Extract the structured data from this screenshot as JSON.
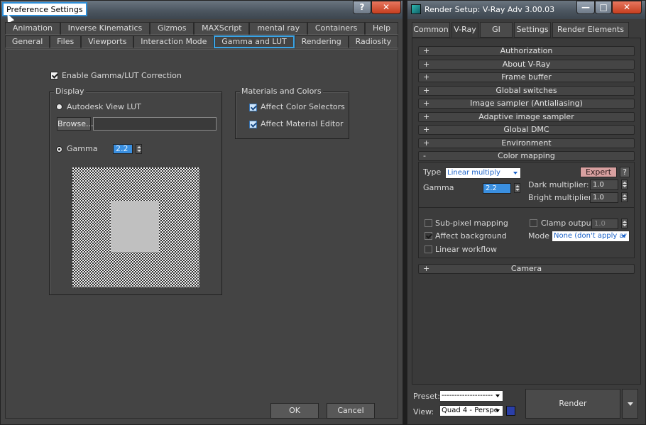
{
  "preferences": {
    "title": "Preference Settings",
    "help_glyph": "?",
    "close_glyph": "✕",
    "tabs_row1": [
      "Animation",
      "Inverse Kinematics",
      "Gizmos",
      "MAXScript",
      "mental ray",
      "Containers",
      "Help"
    ],
    "tabs_row2": [
      "General",
      "Files",
      "Viewports",
      "Interaction Mode",
      "Gamma and LUT",
      "Rendering",
      "Radiosity"
    ],
    "active_tab": "Gamma and LUT",
    "enable_gamma_label": "Enable Gamma/LUT Correction",
    "display_group": "Display",
    "autodesk_lut_label": "Autodesk View LUT",
    "browse_label": "Browse...",
    "lut_path": "",
    "gamma_label": "Gamma",
    "gamma_value": "2.2",
    "materials_group": "Materials and Colors",
    "affect_color_selectors": "Affect Color Selectors",
    "affect_material_editor": "Affect Material Editor",
    "ok_label": "OK",
    "cancel_label": "Cancel"
  },
  "render_setup": {
    "title": "Render Setup: V-Ray Adv 3.00.03",
    "tabs": [
      "Common",
      "V-Ray",
      "GI",
      "Settings",
      "Render Elements"
    ],
    "active_tab": "V-Ray",
    "rollouts_top": [
      {
        "sign": "+",
        "label": "Authorization"
      },
      {
        "sign": "+",
        "label": "About V-Ray"
      },
      {
        "sign": "+",
        "label": "Frame buffer"
      },
      {
        "sign": "+",
        "label": "Global switches"
      },
      {
        "sign": "+",
        "label": "Image sampler (Antialiasing)"
      },
      {
        "sign": "+",
        "label": "Adaptive image sampler"
      },
      {
        "sign": "+",
        "label": "Global DMC"
      },
      {
        "sign": "+",
        "label": "Environment"
      }
    ],
    "color_mapping": {
      "sign": "-",
      "label": "Color mapping",
      "type_label": "Type",
      "type_value": "Linear multiply",
      "expert_label": "Expert",
      "help_label": "?",
      "gamma_label": "Gamma",
      "gamma_value": "2.2",
      "dark_multiplier_label": "Dark multiplier:",
      "dark_multiplier_value": "1.0",
      "bright_multiplier_label": "Bright multiplier:",
      "bright_multiplier_value": "1.0",
      "sub_pixel_label": "Sub-pixel mapping",
      "clamp_output_label": "Clamp output",
      "clamp_value": "1.0",
      "affect_background_label": "Affect background",
      "mode_label": "Mode",
      "mode_value": "None (don't apply ar",
      "linear_workflow_label": "Linear workflow"
    },
    "camera_rollout": {
      "sign": "+",
      "label": "Camera"
    },
    "preset_label": "Preset:",
    "preset_value": "--------------------",
    "view_label": "View:",
    "view_value": "Quad 4 - Perspe",
    "render_label": "Render",
    "min_glyph": "—",
    "max_glyph": "□",
    "close_glyph": "✕"
  },
  "colors": {
    "accent_blue": "#3aa4e6",
    "value_blue": "#3a8fe0",
    "close_red": "#c43d1e",
    "expert_pink": "#d8a0a0"
  }
}
